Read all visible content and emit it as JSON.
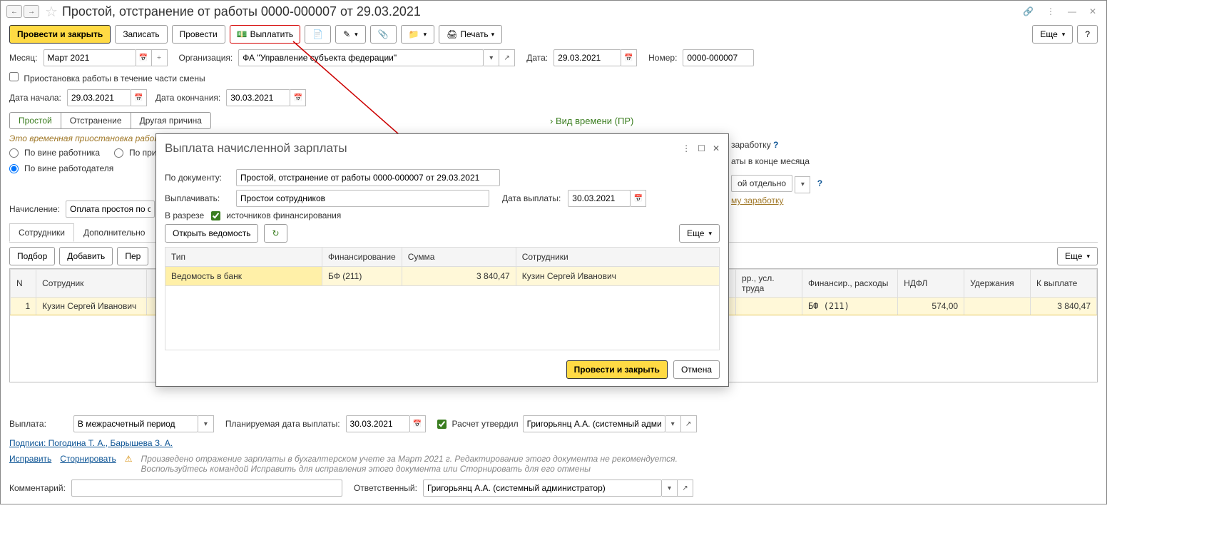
{
  "title": "Простой, отстранение от работы 0000-000007 от 29.03.2021",
  "toolbar": {
    "post_close": "Провести и закрыть",
    "save": "Записать",
    "post": "Провести",
    "pay": "Выплатить",
    "print": "Печать",
    "more": "Еще",
    "help": "?"
  },
  "header": {
    "month_label": "Месяц:",
    "month": "Март 2021",
    "org_label": "Организация:",
    "org": "ФА \"Управление субъекта федерации\"",
    "date_label": "Дата:",
    "date": "29.03.2021",
    "num_label": "Номер:",
    "num": "0000-000007"
  },
  "suspend_partial": "Приостановка работы в течение части смены",
  "start_label": "Дата начала:",
  "start_date": "29.03.2021",
  "end_label": "Дата окончания:",
  "end_date": "30.03.2021",
  "toggle": {
    "idle": "Простой",
    "removal": "Отстранение",
    "other": "Другая причина"
  },
  "time_type": "Вид времени (ПР)",
  "hint": "Это временная приостановка работы",
  "radios": {
    "worker": "По вине работника",
    "pri": "По при",
    "employer": "По вине работодателя"
  },
  "side": {
    "s1": "заработку",
    "s2": "аты в конце месяца",
    "s3": "ой отдельно",
    "s4": "му заработку"
  },
  "accrual_label": "Начисление:",
  "accrual": "Оплата простоя по ср",
  "tabs": {
    "emp": "Сотрудники",
    "extra": "Дополнительно"
  },
  "table_toolbar": {
    "select": "Подбор",
    "add": "Добавить",
    "per": "Пер",
    "more": "Еще"
  },
  "grid": {
    "headers": {
      "n": "N",
      "emp": "Сотрудник",
      "corr": "рр., усл. труда",
      "fin": "Финансир., расходы",
      "ndfl": "НДФЛ",
      "hold": "Удержания",
      "topay": "К выплате"
    },
    "row": {
      "n": "1",
      "emp": "Кузин Сергей Иванович",
      "fin": "БФ (211)",
      "ndfl": "574,00",
      "topay": "3 840,47"
    }
  },
  "footer": {
    "pay_label": "Выплата:",
    "pay_val": "В межрасчетный период",
    "plan_label": "Планируемая дата выплаты:",
    "plan_date": "30.03.2021",
    "calc_approved": "Расчет утвердил",
    "approver": "Григорьянц А.А. (системный адми",
    "sign": "Подписи: Погодина Т. А., Барышева З. А.",
    "fix": "Исправить",
    "storno": "Сторнировать",
    "warn1": "Произведено отражение зарплаты в бухгалтерском учете за Март 2021 г. Редактирование этого документа не рекомендуется.",
    "warn2": "Воспользуйтесь командой Исправить для исправления этого документа или Сторнировать для его отмены",
    "comment_label": "Комментарий:",
    "resp_label": "Ответственный:",
    "resp": "Григорьянц А.А. (системный администратор)"
  },
  "dialog": {
    "title": "Выплата начисленной зарплаты",
    "doc_label": "По документу:",
    "doc": "Простой, отстранение от работы 0000-000007 от 29.03.2021",
    "pay_label": "Выплачивать:",
    "pay": "Простои сотрудников",
    "paydate_label": "Дата выплаты:",
    "paydate": "30.03.2021",
    "split_label": "В разрезе",
    "split_val": "источников финансирования",
    "open": "Открыть ведомость",
    "more": "Еще",
    "headers": {
      "type": "Тип",
      "fin": "Финансирование",
      "sum": "Сумма",
      "emp": "Сотрудники"
    },
    "row": {
      "type": "Ведомость в банк",
      "fin": "БФ (211)",
      "sum": "3 840,47",
      "emp": "Кузин Сергей Иванович"
    },
    "post_close": "Провести и закрыть",
    "cancel": "Отмена"
  }
}
